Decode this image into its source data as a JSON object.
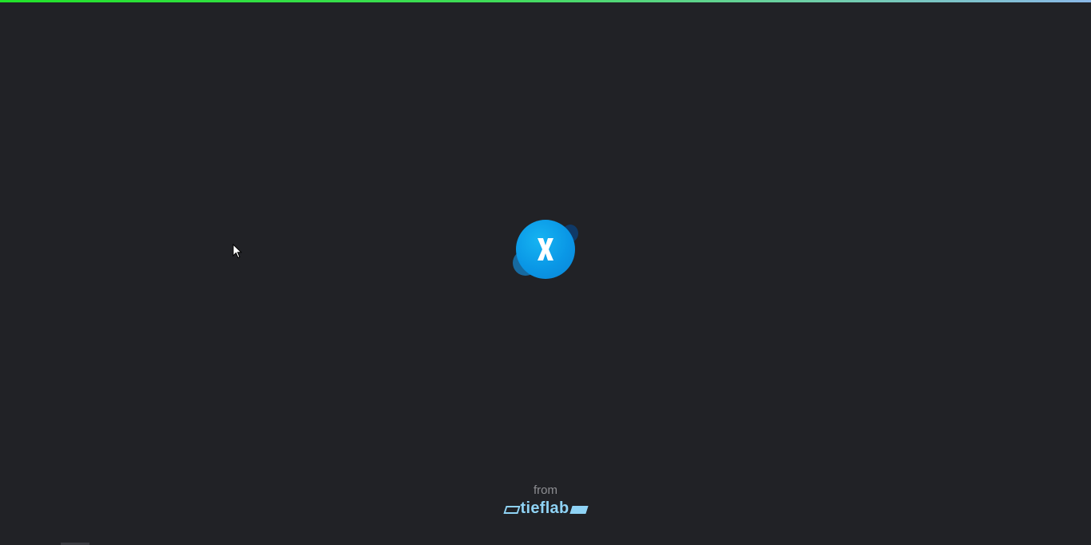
{
  "loader": {
    "progress_fraction": 1.0,
    "progress_colors": [
      "#22e22a",
      "#8ab8e8"
    ]
  },
  "logo": {
    "letter": "X",
    "icon": "app-logo-icon",
    "accent_color": "#0a97e6"
  },
  "branding": {
    "from_label": "from",
    "company_name": "tieflab",
    "color": "#8fd3f5"
  },
  "background_color": "#212226"
}
